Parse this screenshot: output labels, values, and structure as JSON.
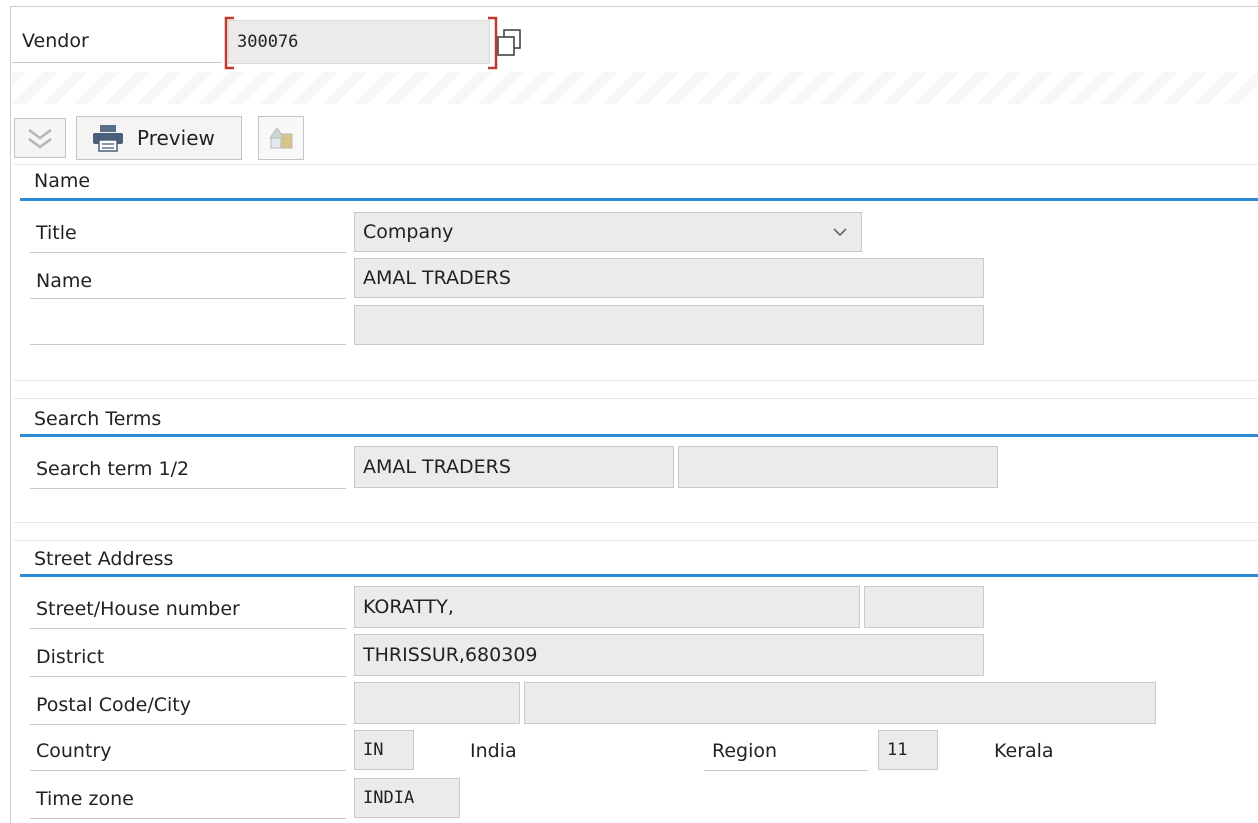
{
  "vendor": {
    "label": "Vendor",
    "value": "300076"
  },
  "toolbar": {
    "preview_label": "Preview"
  },
  "name_section": {
    "title": "Name",
    "title_label": "Title",
    "title_value": "Company",
    "name_label": "Name",
    "name_value": "AMAL TRADERS",
    "name2_value": ""
  },
  "search_section": {
    "title": "Search Terms",
    "term_label": "Search term 1/2",
    "term1_value": "AMAL TRADERS",
    "term2_value": ""
  },
  "address_section": {
    "title": "Street Address",
    "street_label": "Street/House number",
    "street_value": "KORATTY,",
    "house_value": "",
    "district_label": "District",
    "district_value": "THRISSUR,680309",
    "postal_label": "Postal Code/City",
    "postal_value": "",
    "city_value": "",
    "country_label": "Country",
    "country_code": "IN",
    "country_name": "India",
    "region_label": "Region",
    "region_code": "11",
    "region_name": "Kerala",
    "timezone_label": "Time zone",
    "timezone_value": "INDIA"
  },
  "colors": {
    "accent": "#2b8bd6",
    "field_bg": "#ecebea",
    "focus_bracket": "#c0392b"
  }
}
